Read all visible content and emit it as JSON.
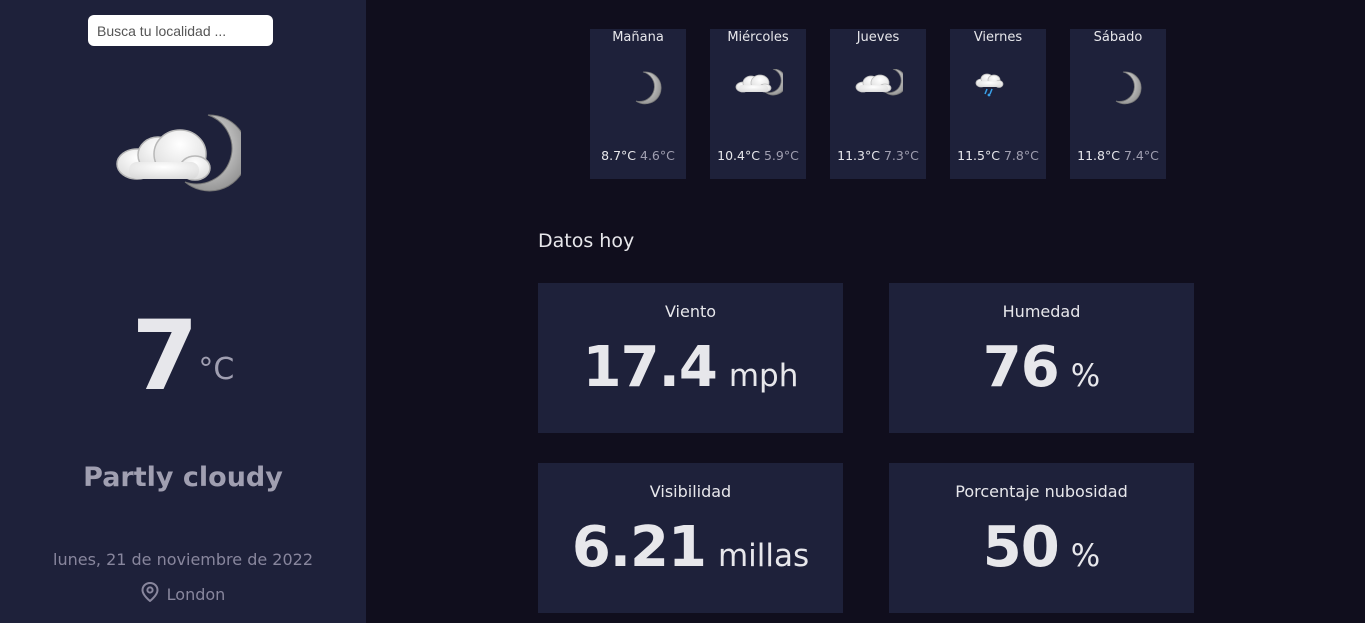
{
  "search": {
    "placeholder": "Busca tu localidad ..."
  },
  "current": {
    "icon": "partly-cloudy-night-icon",
    "temperature": "7",
    "unit": "°C",
    "condition": "Partly cloudy",
    "date": "lunes, 21 de noviembre de 2022",
    "location": "London",
    "location_icon": "map-pin-icon"
  },
  "forecast": [
    {
      "day": "Mañana",
      "icon": "moon-icon",
      "max": "8.7°C",
      "min": "4.6°C"
    },
    {
      "day": "Miércoles",
      "icon": "partly-cloudy-night-icon",
      "max": "10.4°C",
      "min": "5.9°C"
    },
    {
      "day": "Jueves",
      "icon": "partly-cloudy-night-icon",
      "max": "11.3°C",
      "min": "7.3°C"
    },
    {
      "day": "Viernes",
      "icon": "light-rain-icon",
      "max": "11.5°C",
      "min": "7.8°C"
    },
    {
      "day": "Sábado",
      "icon": "moon-icon",
      "max": "11.8°C",
      "min": "7.4°C"
    }
  ],
  "today": {
    "title": "Datos hoy",
    "wind": {
      "label": "Viento",
      "value": "17.4",
      "unit": "mph"
    },
    "humidity": {
      "label": "Humedad",
      "value": "76",
      "unit": "%"
    },
    "visibility": {
      "label": "Visibilidad",
      "value": "6.21",
      "unit": "millas"
    },
    "cloud": {
      "label": "Porcentaje nubosidad",
      "value": "50",
      "unit": "%"
    }
  },
  "colors": {
    "background": "#100e1d",
    "panel": "#1e213a",
    "text": "#e7e7eb",
    "muted": "#a09fb1"
  }
}
